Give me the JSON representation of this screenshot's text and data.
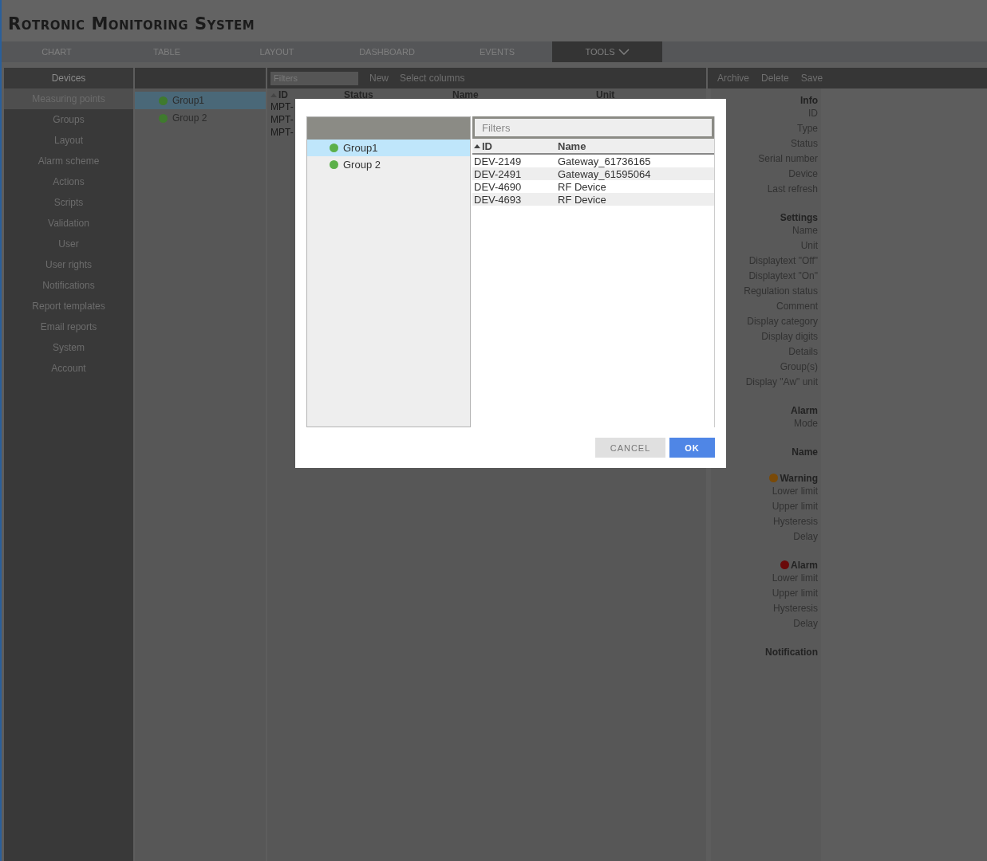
{
  "app": {
    "title": "Rotronic Monitoring System"
  },
  "nav": [
    {
      "label": "CHART",
      "selected": false
    },
    {
      "label": "TABLE",
      "selected": false
    },
    {
      "label": "LAYOUT",
      "selected": false
    },
    {
      "label": "DASHBOARD",
      "selected": false
    },
    {
      "label": "EVENTS",
      "selected": false
    },
    {
      "label": "TOOLS",
      "selected": true
    }
  ],
  "sidebar": {
    "heading": "Devices",
    "items": [
      {
        "label": "Measuring points",
        "selected": true
      },
      {
        "label": "Groups",
        "selected": false
      },
      {
        "label": "Layout",
        "selected": false
      },
      {
        "label": "Alarm scheme",
        "selected": false
      },
      {
        "label": "Actions",
        "selected": false
      },
      {
        "label": "Scripts",
        "selected": false
      },
      {
        "label": "Validation",
        "selected": false
      },
      {
        "label": "User",
        "selected": false
      },
      {
        "label": "User rights",
        "selected": false
      },
      {
        "label": "Notifications",
        "selected": false
      },
      {
        "label": "Report templates",
        "selected": false
      },
      {
        "label": "Email reports",
        "selected": false
      },
      {
        "label": "System",
        "selected": false
      },
      {
        "label": "Account",
        "selected": false
      }
    ]
  },
  "groups": [
    {
      "label": "Group1",
      "selected": true,
      "color": "#3f7a2e"
    },
    {
      "label": "Group 2",
      "selected": false,
      "color": "#3f7a2e"
    }
  ],
  "table": {
    "filter_placeholder": "Filters",
    "actions": [
      "New",
      "Select columns"
    ],
    "columns": [
      "ID",
      "Status",
      "Name",
      "Unit"
    ],
    "rows": [
      "MPT-",
      "MPT-",
      "MPT-"
    ]
  },
  "details": {
    "actions": [
      "Archive",
      "Delete",
      "Save"
    ],
    "sections": [
      {
        "title": "Info",
        "fields": [
          "ID",
          "Type",
          "Status",
          "Serial number",
          "Device",
          "Last refresh"
        ]
      },
      {
        "title": "Settings",
        "fields": [
          "Name",
          "Unit",
          "Displaytext \"Off\"",
          "Displaytext \"On\"",
          "Regulation status",
          "Comment",
          "Display category",
          "Display digits",
          "Details",
          "Group(s)",
          "Display \"Aw\" unit"
        ]
      },
      {
        "title": "Alarm",
        "fields": [
          "Mode"
        ]
      },
      {
        "title": "Name"
      },
      {
        "title": "Warning",
        "color": "#7a4a08",
        "fields": [
          "Lower limit",
          "Upper limit",
          "Hysteresis",
          "Delay"
        ]
      },
      {
        "title": "Alarm",
        "color": "#6a0a0a",
        "fields": [
          "Lower limit",
          "Upper limit",
          "Hysteresis",
          "Delay"
        ]
      },
      {
        "title": "Notification"
      }
    ]
  },
  "dialog": {
    "groups": [
      {
        "label": "Group1",
        "selected": true,
        "color": "#5cb04a"
      },
      {
        "label": "Group 2",
        "selected": false,
        "color": "#5cb04a"
      }
    ],
    "filter_placeholder": "Filters",
    "columns": [
      "ID",
      "Name"
    ],
    "rows": [
      [
        "DEV-2149",
        "Gateway_61736165"
      ],
      [
        "DEV-2491",
        "Gateway_61595064"
      ],
      [
        "DEV-4690",
        "RF Device"
      ],
      [
        "DEV-4693",
        "RF Device"
      ]
    ],
    "buttons": [
      "CANCEL",
      "OK"
    ]
  }
}
